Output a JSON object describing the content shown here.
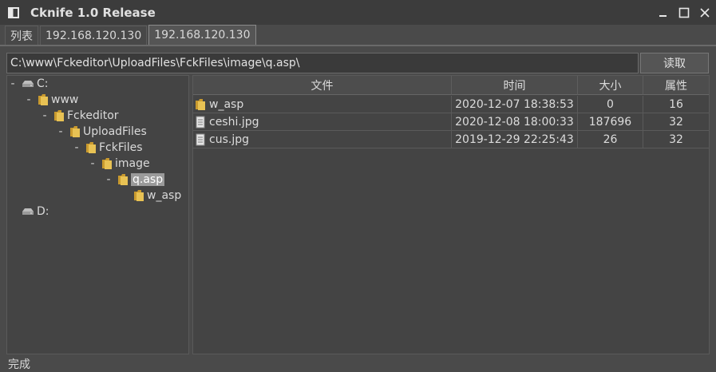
{
  "window": {
    "title": "Cknife 1.0 Release"
  },
  "tabs": [
    {
      "label": "列表",
      "active": false
    },
    {
      "label": "192.168.120.130",
      "active": false
    },
    {
      "label": "192.168.120.130",
      "active": true
    }
  ],
  "pathbar": {
    "path": "C:\\www\\Fckeditor\\UploadFiles\\FckFiles\\image\\q.asp\\",
    "read_label": "读取"
  },
  "tree": {
    "nodes": [
      {
        "label": "C:",
        "icon": "drive-icon",
        "toggle": "-"
      },
      {
        "label": "www",
        "icon": "folder-icon",
        "toggle": "-"
      },
      {
        "label": "Fckeditor",
        "icon": "folder-icon",
        "toggle": "-"
      },
      {
        "label": "UploadFiles",
        "icon": "folder-icon",
        "toggle": "-"
      },
      {
        "label": "FckFiles",
        "icon": "folder-icon",
        "toggle": "-"
      },
      {
        "label": "image",
        "icon": "folder-icon",
        "toggle": "-"
      },
      {
        "label": "q.asp",
        "icon": "folder-icon",
        "toggle": "-",
        "selected": true
      },
      {
        "label": "w_asp",
        "icon": "folder-icon",
        "toggle": ""
      },
      {
        "label": "D:",
        "icon": "drive-icon",
        "toggle": ""
      }
    ]
  },
  "files": {
    "headers": {
      "name": "文件",
      "time": "时间",
      "size": "大小",
      "attr": "属性"
    },
    "rows": [
      {
        "name": "w_asp",
        "icon": "folder-icon",
        "time": "2020-12-07 18:38:53",
        "size": "0",
        "attr": "16"
      },
      {
        "name": "ceshi.jpg",
        "icon": "file-icon",
        "time": "2020-12-08 18:00:33",
        "size": "187696",
        "attr": "32"
      },
      {
        "name": "cus.jpg",
        "icon": "file-icon",
        "time": "2019-12-29 22:25:43",
        "size": "26",
        "attr": "32"
      }
    ]
  },
  "status": {
    "text": "完成"
  },
  "colors": {
    "background": "#4a4a4a",
    "folder": "#e8c254",
    "selection": "#9a9a9a"
  }
}
